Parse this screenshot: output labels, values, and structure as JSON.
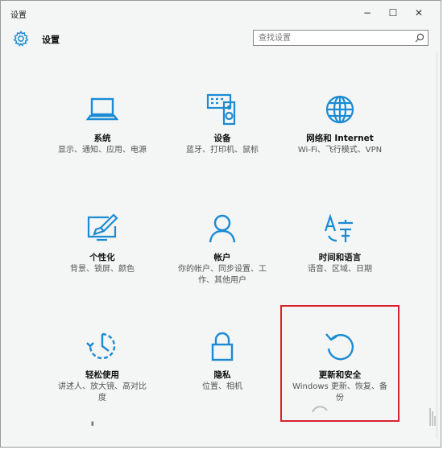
{
  "window": {
    "title": "设置",
    "controls": {
      "minimize": "−",
      "maximize": "☐",
      "close": "✕"
    }
  },
  "header": {
    "icon": "gear-icon",
    "heading": "设置"
  },
  "search": {
    "placeholder": "查找设置",
    "icon": "search-icon"
  },
  "accent_color": "#1a8bd4",
  "highlight_color": "#d9232e",
  "tiles": [
    {
      "icon": "laptop-icon",
      "name": "系统",
      "description": "显示、通知、应用、电源"
    },
    {
      "icon": "keyboard-speaker-icon",
      "name": "设备",
      "description": "蓝牙、打印机、鼠标"
    },
    {
      "icon": "globe-icon",
      "name": "网络和 Internet",
      "description": "Wi-Fi、飞行模式、VPN"
    },
    {
      "icon": "paint-monitor-icon",
      "name": "个性化",
      "description": "背景、锁屏、颜色"
    },
    {
      "icon": "person-icon",
      "name": "帐户",
      "description": "你的帐户、同步设置、工作、其他用户"
    },
    {
      "icon": "time-language-icon",
      "name": "时间和语言",
      "description": "语音、区域、日期"
    },
    {
      "icon": "ease-of-access-icon",
      "name": "轻松使用",
      "description": "讲述人、放大镜、高对比度"
    },
    {
      "icon": "lock-icon",
      "name": "隐私",
      "description": "位置、相机"
    },
    {
      "icon": "refresh-icon",
      "name": "更新和安全",
      "description": "Windows 更新、恢复、备份"
    }
  ]
}
